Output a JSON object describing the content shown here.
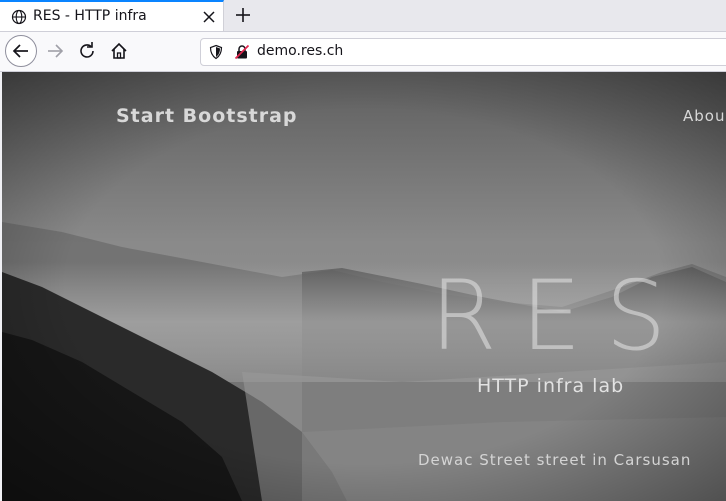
{
  "browser": {
    "tab_title": "RES - HTTP infra",
    "url": "demo.res.ch",
    "icons": {
      "tab": "globe-icon",
      "close": "close-icon",
      "new_tab": "plus-icon",
      "back": "arrow-left-icon",
      "forward": "arrow-right-icon",
      "reload": "reload-icon",
      "home": "home-icon",
      "tracking": "shield-icon",
      "insecure": "insecure-lock-icon"
    }
  },
  "page": {
    "brand": "Start Bootstrap",
    "nav_about": "Abou",
    "heading": "RES",
    "subheading": "HTTP infra lab",
    "address": "Dewac Street street in Carsusan"
  }
}
